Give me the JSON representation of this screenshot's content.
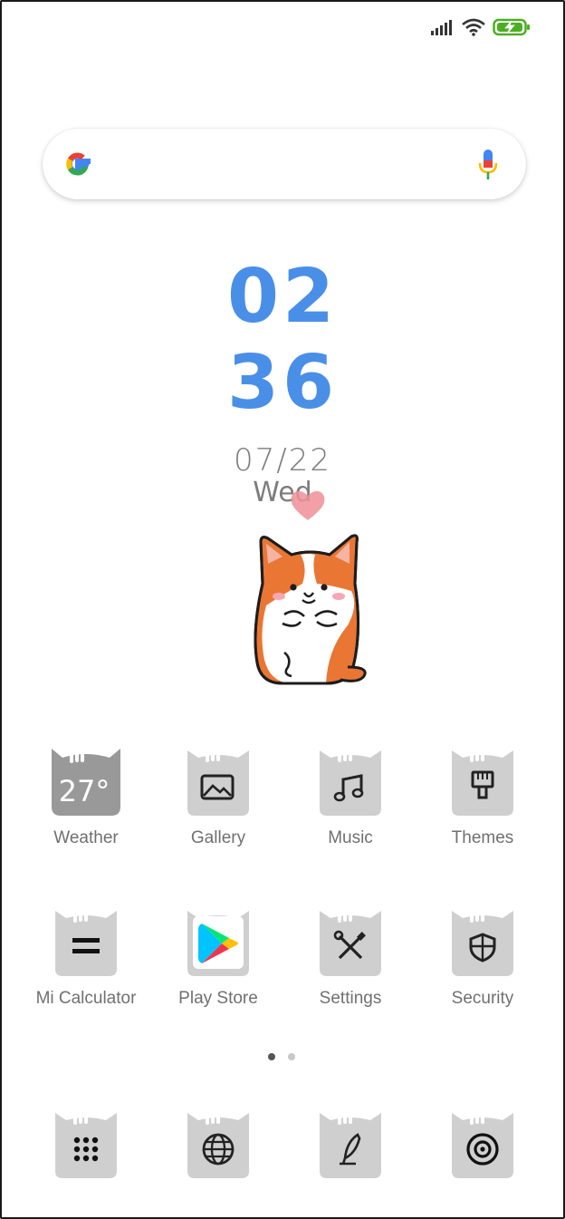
{
  "status_bar": {
    "signal_icon": "signal-icon",
    "wifi_icon": "wifi-icon",
    "battery_icon": "battery-charging-icon",
    "battery_color": "#4caf22"
  },
  "search": {
    "logo_icon": "google-g-icon",
    "mic_icon": "microphone-icon"
  },
  "clock": {
    "hours": "02",
    "minutes": "36",
    "date": "07/22",
    "day": "Wed",
    "color": "#4a8fe7"
  },
  "apps": [
    {
      "label": "Weather",
      "icon": "weather-icon",
      "temp": "27°"
    },
    {
      "label": "Gallery",
      "icon": "image-icon"
    },
    {
      "label": "Music",
      "icon": "music-note-icon"
    },
    {
      "label": "Themes",
      "icon": "paintbrush-icon"
    },
    {
      "label": "Mi Calculator",
      "icon": "equals-icon"
    },
    {
      "label": "Play Store",
      "icon": "play-store-icon"
    },
    {
      "label": "Settings",
      "icon": "wrench-screwdriver-icon"
    },
    {
      "label": "Security",
      "icon": "shield-icon"
    }
  ],
  "dock": [
    {
      "icon": "app-drawer-icon"
    },
    {
      "icon": "globe-icon"
    },
    {
      "icon": "feather-pen-icon"
    },
    {
      "icon": "camera-icon"
    }
  ],
  "pager": {
    "pages": 2,
    "active": 1
  }
}
